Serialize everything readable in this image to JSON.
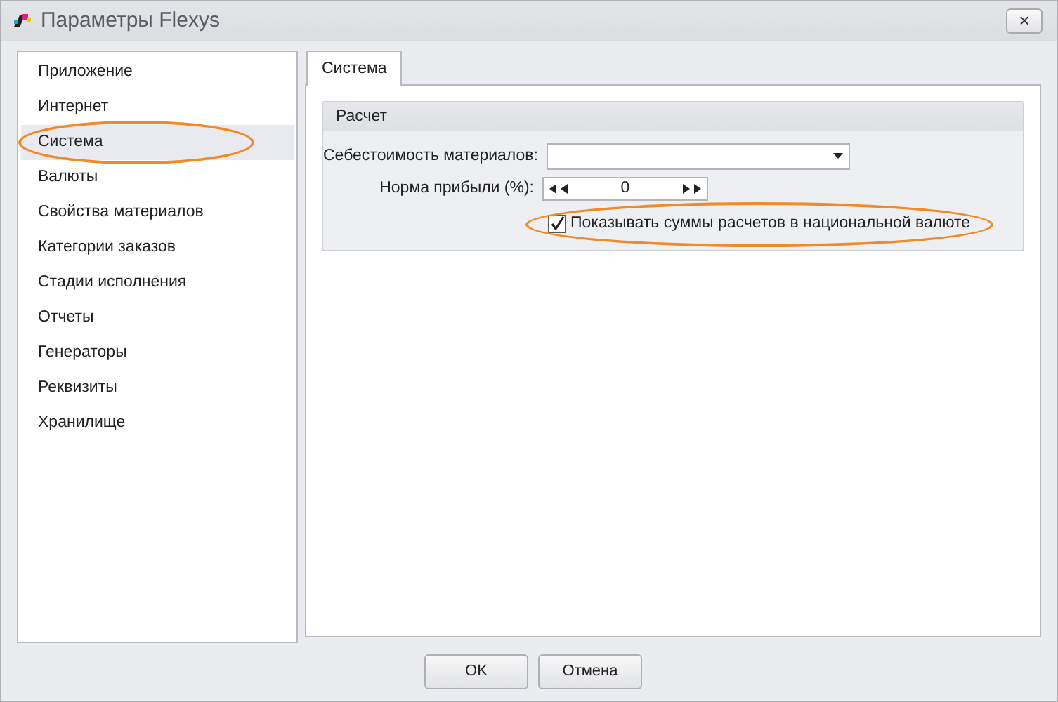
{
  "window": {
    "title": "Параметры Flexys",
    "close_label": "×"
  },
  "sidebar": {
    "items": [
      {
        "label": "Приложение",
        "selected": false,
        "highlighted": false
      },
      {
        "label": "Интернет",
        "selected": false,
        "highlighted": false
      },
      {
        "label": "Система",
        "selected": true,
        "highlighted": true
      },
      {
        "label": "Валюты",
        "selected": false,
        "highlighted": false
      },
      {
        "label": "Свойства материалов",
        "selected": false,
        "highlighted": false
      },
      {
        "label": "Категории заказов",
        "selected": false,
        "highlighted": false
      },
      {
        "label": "Стадии исполнения",
        "selected": false,
        "highlighted": false
      },
      {
        "label": "Отчеты",
        "selected": false,
        "highlighted": false
      },
      {
        "label": "Генераторы",
        "selected": false,
        "highlighted": false
      },
      {
        "label": "Реквизиты",
        "selected": false,
        "highlighted": false
      },
      {
        "label": "Хранилище",
        "selected": false,
        "highlighted": false
      }
    ]
  },
  "tabs": [
    {
      "label": "Система",
      "selected": true
    }
  ],
  "group": {
    "title": "Расчет",
    "cost_field": {
      "label": "Себестоимость материалов:"
    },
    "profit_field": {
      "label": "Норма прибыли (%):",
      "value": "0"
    },
    "checkbox": {
      "label": "Показывать суммы расчетов в национальной валюте",
      "checked": true,
      "highlighted": true
    }
  },
  "buttons": [
    "OK",
    "Отмена"
  ]
}
